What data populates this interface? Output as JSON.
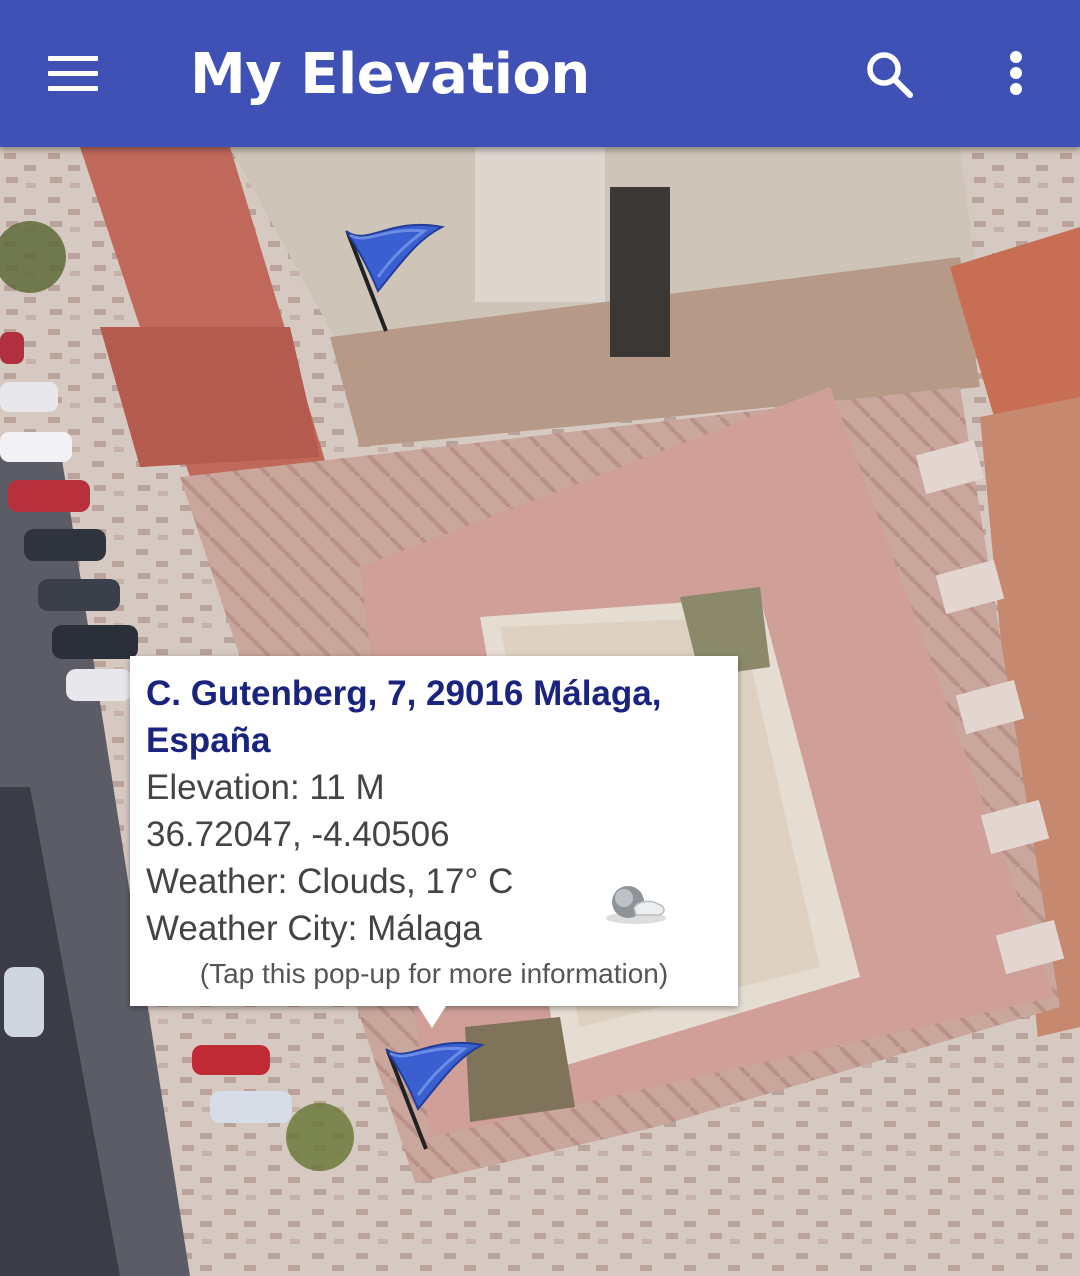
{
  "appbar": {
    "title": "My Elevation",
    "menu_icon": "hamburger-menu-icon",
    "search_icon": "search-icon",
    "overflow_icon": "more-vert-icon",
    "background_color": "#3f51b5"
  },
  "map": {
    "type": "satellite",
    "markers": [
      "flag-marker",
      "flag-marker"
    ],
    "marker_color": "#3a5fd0"
  },
  "popup": {
    "address": "C. Gutenberg, 7, 29016 Málaga, España",
    "elevation": "Elevation: 11 M",
    "coordinates": "36.72047, -4.40506",
    "weather": "Weather: Clouds,  17° C",
    "weather_city": "Weather City: Málaga",
    "hint": "(Tap this pop-up for more information)",
    "weather_icon": "clouds-weather-icon"
  }
}
